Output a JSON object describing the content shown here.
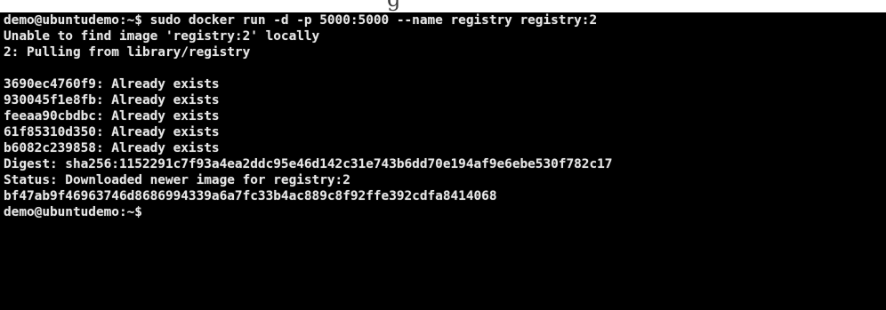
{
  "top_strip": {
    "text": "g"
  },
  "terminal": {
    "lines": [
      "demo@ubuntudemo:~$ sudo docker run -d -p 5000:5000 --name registry registry:2",
      "Unable to find image 'registry:2' locally",
      "2: Pulling from library/registry",
      "",
      "3690ec4760f9: Already exists",
      "930045f1e8fb: Already exists",
      "feeaa90cbdbc: Already exists",
      "61f85310d350: Already exists",
      "b6082c239858: Already exists",
      "Digest: sha256:1152291c7f93a4ea2ddc95e46d142c31e743b6dd70e194af9e6ebe530f782c17",
      "Status: Downloaded newer image for registry:2",
      "bf47ab9f46963746d8686994339a6a7fc33b4ac889c8f92ffe392cdfa8414068",
      "demo@ubuntudemo:~$"
    ],
    "colors": {
      "background": "#000000",
      "text": "#e6e6e6"
    }
  }
}
